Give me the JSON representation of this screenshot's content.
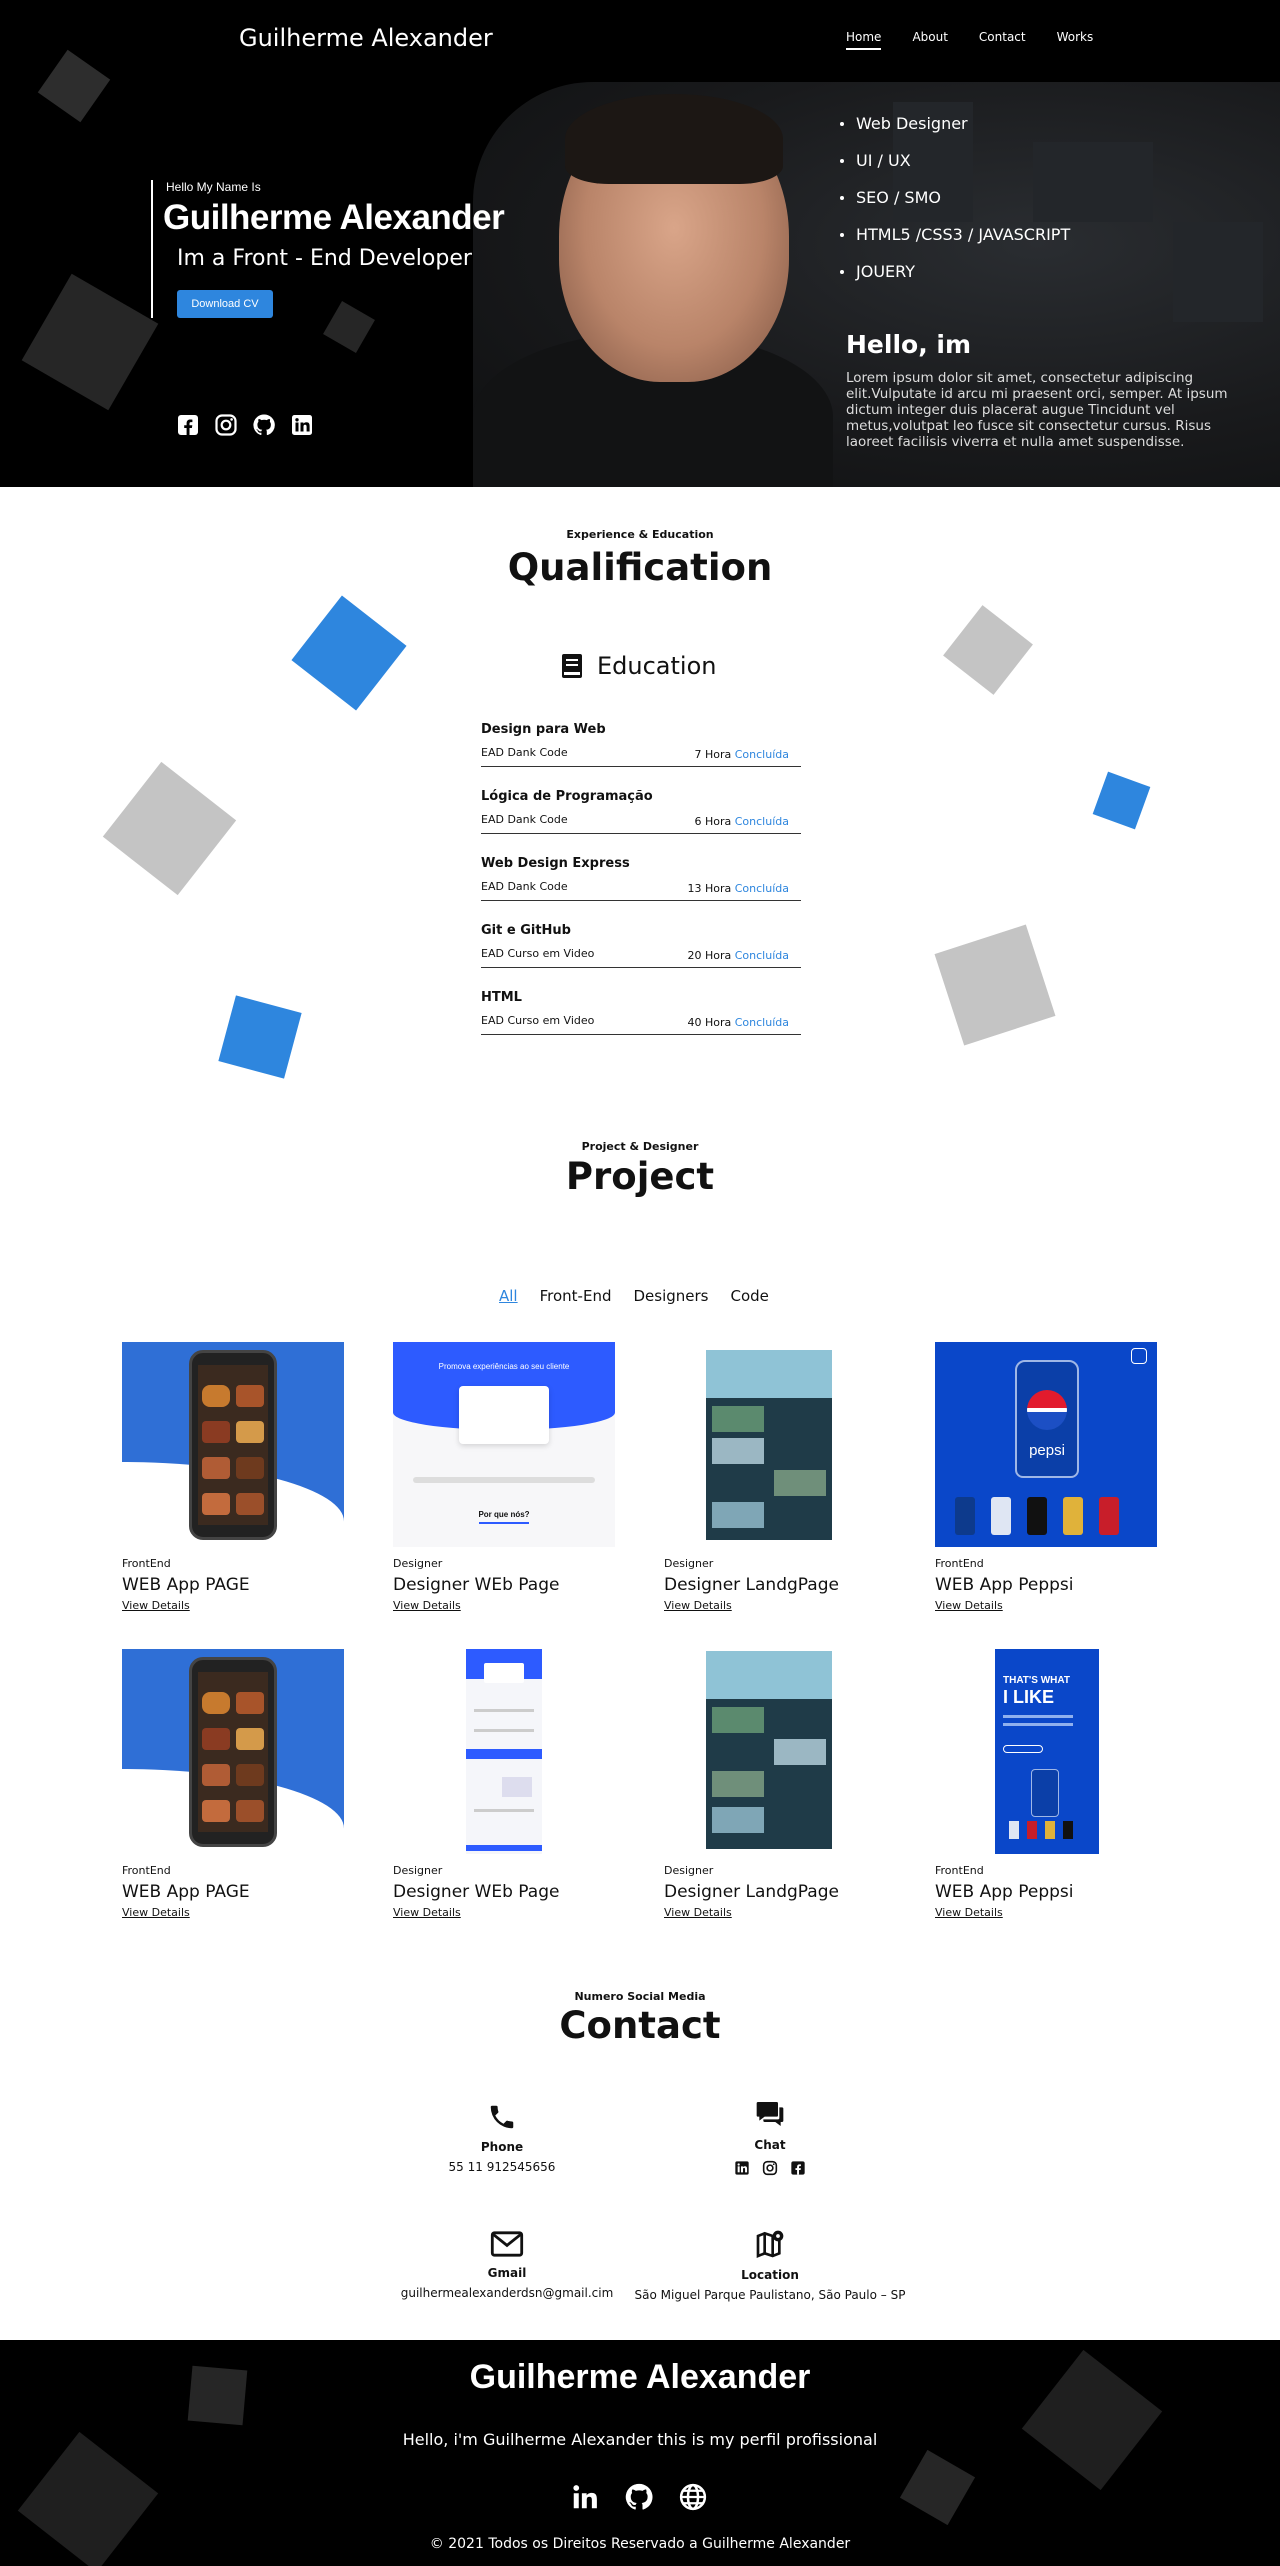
{
  "nav": {
    "brand": "Guilherme Alexander",
    "links": [
      "Home",
      "About",
      "Contact",
      "Works"
    ]
  },
  "hero": {
    "hello_small": "Hello My Name Is",
    "name": "Guilherme Alexander",
    "role": "Im a Front - End Developer",
    "cv_button": "Download CV",
    "skills": [
      "Web Designer",
      "UI / UX",
      "SEO / SMO",
      "HTML5 /CSS3 / JAVASCRIPT",
      "JOUERY"
    ],
    "hello_im": "Hello, im",
    "paragraph": "Lorem ipsum dolor sit amet, consectetur adipiscing elit.Vulputate id arcu mi praesent orci, semper. At ipsum dictum integer duis placerat augue Tincidunt vel metus,volutpat leo fusce sit consectetur cursus. Risus laoreet facilisis viverra et nulla amet suspendisse.",
    "social_icons": [
      "facebook-icon",
      "instagram-icon",
      "github-icon",
      "linkedin-icon"
    ]
  },
  "qualification": {
    "small": "Experience & Education",
    "title": "Qualification",
    "education_title": "Education",
    "items": [
      {
        "course": "Design para Web",
        "school": "EAD Dank Code",
        "duration": "7 Hora",
        "status": "Concluída"
      },
      {
        "course": "Lógica de Programação",
        "school": "EAD Dank Code",
        "duration": "6 Hora",
        "status": "Concluída"
      },
      {
        "course": "Web Design Express",
        "school": "EAD Dank Code",
        "duration": "13 Hora",
        "status": "Concluída"
      },
      {
        "course": "Git e GitHub",
        "school": "EAD Curso em Video",
        "duration": "20 Hora",
        "status": "Concluída"
      },
      {
        "course": "HTML",
        "school": "EAD Curso em Video",
        "duration": "40 Hora",
        "status": "Concluída"
      }
    ]
  },
  "project": {
    "small": "Project & Designer",
    "title": "Project",
    "filters": [
      "All",
      "Front-End",
      "Designers",
      "Code"
    ],
    "cards": [
      {
        "category": "FrontEnd",
        "title": "WEB App PAGE",
        "link": "View Details"
      },
      {
        "category": "Designer",
        "title": "Designer WEb Page",
        "link": "View Details"
      },
      {
        "category": "Designer",
        "title": "Designer LandgPage",
        "link": "View Details"
      },
      {
        "category": "FrontEnd",
        "title": "WEB App Peppsi",
        "link": "View Details"
      },
      {
        "category": "FrontEnd",
        "title": "WEB App PAGE",
        "link": "View Details"
      },
      {
        "category": "Designer",
        "title": "Designer WEb Page",
        "link": "View Details"
      },
      {
        "category": "Designer",
        "title": "Designer LandgPage",
        "link": "View Details"
      },
      {
        "category": "FrontEnd",
        "title": "WEB App Peppsi",
        "link": "View Details"
      }
    ],
    "thumb_text": {
      "promova": "Promova experiências ao seu cliente",
      "por_que": "Por que nós?",
      "pepsi": "pepsi",
      "thats": "THAT'S WHAT",
      "ilike": "I LIKE"
    }
  },
  "contact": {
    "small": "Numero Social Media",
    "title": "Contact",
    "phone_label": "Phone",
    "phone_value": "55 11 912545656",
    "chat_label": "Chat",
    "gmail_label": "Gmail",
    "gmail_value": "guilhermealexanderdsn@gmail.cim",
    "location_label": "Location",
    "location_value": "São Miguel Parque Paulistano, São Paulo – SP"
  },
  "footer": {
    "name": "Guilherme Alexander",
    "subtitle": "Hello, i'm Guilherme Alexander this is my perfil profissional",
    "copyright": "© 2021 Todos os Direitos Reservado a Guilherme Alexander"
  },
  "colors": {
    "accent": "#2e86de",
    "dark": "#000000",
    "gray_square": "#c4c4c4",
    "blue_square": "#2e86de"
  }
}
